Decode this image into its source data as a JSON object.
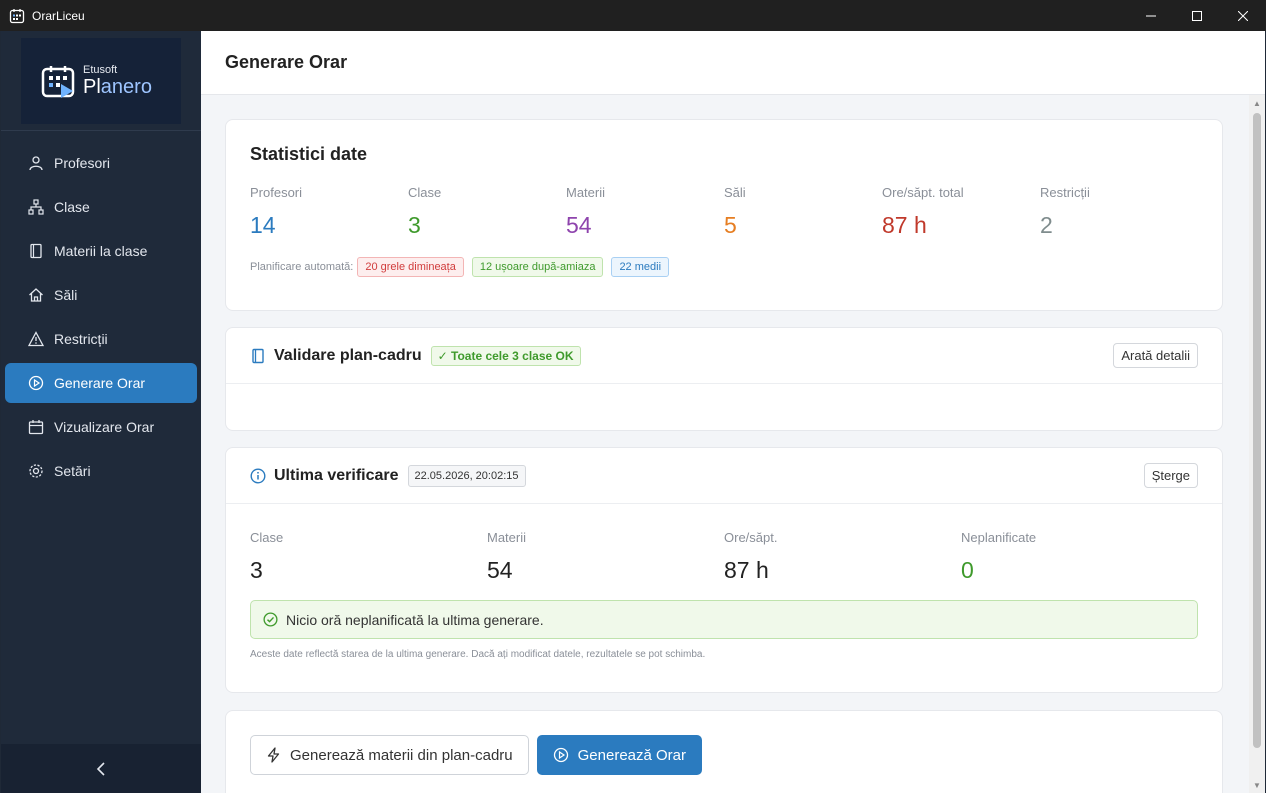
{
  "window": {
    "title": "OrarLiceu"
  },
  "logo": {
    "small": "Etusoft",
    "big_first": "Pl",
    "big_rest": "anero"
  },
  "sidebar": {
    "items": [
      {
        "label": "Profesori",
        "icon": "user-icon"
      },
      {
        "label": "Clase",
        "icon": "hierarchy-icon"
      },
      {
        "label": "Materii la clase",
        "icon": "book-icon"
      },
      {
        "label": "Săli",
        "icon": "home-icon"
      },
      {
        "label": "Restricții",
        "icon": "warning-icon"
      },
      {
        "label": "Generare Orar",
        "icon": "play-circle-icon",
        "active": true
      },
      {
        "label": "Vizualizare Orar",
        "icon": "calendar-icon"
      },
      {
        "label": "Setări",
        "icon": "gear-icon"
      }
    ]
  },
  "header": {
    "title": "Generare Orar"
  },
  "stats_card": {
    "title": "Statistici date",
    "stats": [
      {
        "label": "Profesori",
        "value": "14",
        "color": "#2b7bbf"
      },
      {
        "label": "Clase",
        "value": "3",
        "color": "#3f9a2c"
      },
      {
        "label": "Materii",
        "value": "54",
        "color": "#8e44ad"
      },
      {
        "label": "Săli",
        "value": "5",
        "color": "#e67e22"
      },
      {
        "label": "Ore/săpt. total",
        "value": "87 h",
        "color": "#c0392b"
      },
      {
        "label": "Restricții",
        "value": "2",
        "color": "#7f8c8d"
      }
    ],
    "auto_label": "Planificare automată:",
    "tags": [
      "20 grele dimineața",
      "12 ușoare după-amiaza",
      "22 medii"
    ]
  },
  "validation_card": {
    "title": "Validare plan-cadru",
    "badge": "✓ Toate cele 3 clase OK",
    "details_button": "Arată detalii"
  },
  "last_check_card": {
    "title": "Ultima verificare",
    "date": "22.05.2026, 20:02:15",
    "delete_button": "Șterge",
    "stats": [
      {
        "label": "Clase",
        "value": "3"
      },
      {
        "label": "Materii",
        "value": "54"
      },
      {
        "label": "Ore/săpt.",
        "value": "87 h"
      },
      {
        "label": "Neplanificate",
        "value": "0",
        "color": "#3f9a2c"
      }
    ],
    "success_message": "Nicio oră neplanificată la ultima generare.",
    "note": "Aceste date reflectă starea de la ultima generare. Dacă ați modificat datele, rezultatele se pot schimba."
  },
  "actions": {
    "generate_subjects": "Generează materii din plan-cadru",
    "generate_schedule": "Generează Orar"
  }
}
